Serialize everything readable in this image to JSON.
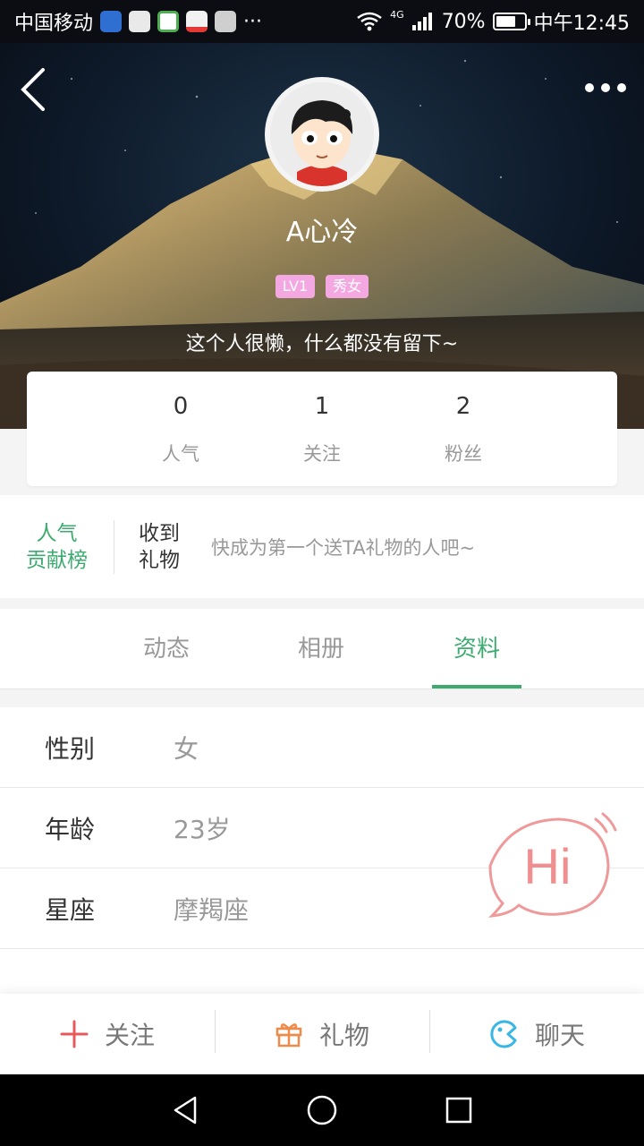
{
  "status_bar": {
    "carrier": "中国移动",
    "more_notifications": "···",
    "network": "4G",
    "battery_percent": "70%",
    "battery_level": 0.7,
    "time": "中午12:45"
  },
  "profile": {
    "nickname": "A心冷",
    "badges": [
      "LV1",
      "秀女"
    ],
    "signature": "这个人很懒，什么都没有留下~"
  },
  "stats": [
    {
      "value": "0",
      "label": "人气"
    },
    {
      "value": "1",
      "label": "关注"
    },
    {
      "value": "2",
      "label": "粉丝"
    }
  ],
  "gifts": {
    "rank_line1": "人气",
    "rank_line2": "贡献榜",
    "received_line1": "收到",
    "received_line2": "礼物",
    "hint": "快成为第一个送TA礼物的人吧~"
  },
  "tabs": [
    {
      "label": "动态"
    },
    {
      "label": "相册"
    },
    {
      "label": "资料"
    }
  ],
  "active_tab": "资料",
  "info": [
    {
      "label": "性别",
      "value": "女"
    },
    {
      "label": "年龄",
      "value": "23岁"
    },
    {
      "label": "星座",
      "value": "摩羯座"
    }
  ],
  "hi_bubble": {
    "text": "Hi"
  },
  "actions": {
    "follow": "关注",
    "gift": "礼物",
    "chat": "聊天"
  },
  "colors": {
    "accent": "#3dab6f",
    "badge": "#f3a8e2",
    "follow_icon": "#e8585a",
    "gift_icon": "#ee8a4a",
    "chat_icon": "#38b7e6",
    "hi_bubble": "#ef9a9a"
  }
}
